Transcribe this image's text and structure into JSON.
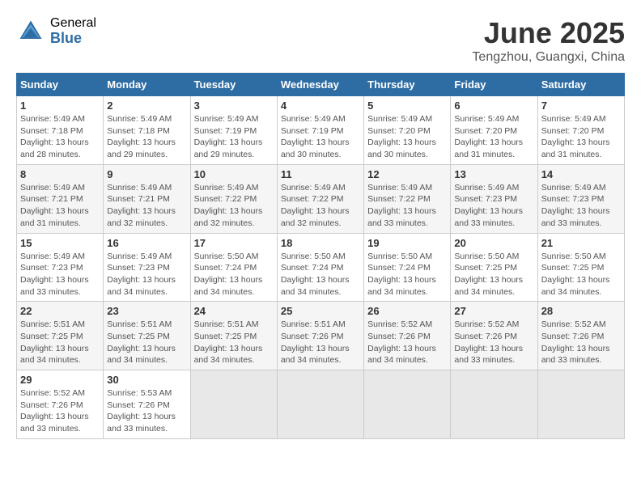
{
  "logo": {
    "general": "General",
    "blue": "Blue"
  },
  "title": "June 2025",
  "location": "Tengzhou, Guangxi, China",
  "weekdays": [
    "Sunday",
    "Monday",
    "Tuesday",
    "Wednesday",
    "Thursday",
    "Friday",
    "Saturday"
  ],
  "weeks": [
    [
      {
        "day": "1",
        "info": "Sunrise: 5:49 AM\nSunset: 7:18 PM\nDaylight: 13 hours\nand 28 minutes."
      },
      {
        "day": "2",
        "info": "Sunrise: 5:49 AM\nSunset: 7:18 PM\nDaylight: 13 hours\nand 29 minutes."
      },
      {
        "day": "3",
        "info": "Sunrise: 5:49 AM\nSunset: 7:19 PM\nDaylight: 13 hours\nand 29 minutes."
      },
      {
        "day": "4",
        "info": "Sunrise: 5:49 AM\nSunset: 7:19 PM\nDaylight: 13 hours\nand 30 minutes."
      },
      {
        "day": "5",
        "info": "Sunrise: 5:49 AM\nSunset: 7:20 PM\nDaylight: 13 hours\nand 30 minutes."
      },
      {
        "day": "6",
        "info": "Sunrise: 5:49 AM\nSunset: 7:20 PM\nDaylight: 13 hours\nand 31 minutes."
      },
      {
        "day": "7",
        "info": "Sunrise: 5:49 AM\nSunset: 7:20 PM\nDaylight: 13 hours\nand 31 minutes."
      }
    ],
    [
      {
        "day": "8",
        "info": "Sunrise: 5:49 AM\nSunset: 7:21 PM\nDaylight: 13 hours\nand 31 minutes."
      },
      {
        "day": "9",
        "info": "Sunrise: 5:49 AM\nSunset: 7:21 PM\nDaylight: 13 hours\nand 32 minutes."
      },
      {
        "day": "10",
        "info": "Sunrise: 5:49 AM\nSunset: 7:22 PM\nDaylight: 13 hours\nand 32 minutes."
      },
      {
        "day": "11",
        "info": "Sunrise: 5:49 AM\nSunset: 7:22 PM\nDaylight: 13 hours\nand 32 minutes."
      },
      {
        "day": "12",
        "info": "Sunrise: 5:49 AM\nSunset: 7:22 PM\nDaylight: 13 hours\nand 33 minutes."
      },
      {
        "day": "13",
        "info": "Sunrise: 5:49 AM\nSunset: 7:23 PM\nDaylight: 13 hours\nand 33 minutes."
      },
      {
        "day": "14",
        "info": "Sunrise: 5:49 AM\nSunset: 7:23 PM\nDaylight: 13 hours\nand 33 minutes."
      }
    ],
    [
      {
        "day": "15",
        "info": "Sunrise: 5:49 AM\nSunset: 7:23 PM\nDaylight: 13 hours\nand 33 minutes."
      },
      {
        "day": "16",
        "info": "Sunrise: 5:49 AM\nSunset: 7:23 PM\nDaylight: 13 hours\nand 34 minutes."
      },
      {
        "day": "17",
        "info": "Sunrise: 5:50 AM\nSunset: 7:24 PM\nDaylight: 13 hours\nand 34 minutes."
      },
      {
        "day": "18",
        "info": "Sunrise: 5:50 AM\nSunset: 7:24 PM\nDaylight: 13 hours\nand 34 minutes."
      },
      {
        "day": "19",
        "info": "Sunrise: 5:50 AM\nSunset: 7:24 PM\nDaylight: 13 hours\nand 34 minutes."
      },
      {
        "day": "20",
        "info": "Sunrise: 5:50 AM\nSunset: 7:25 PM\nDaylight: 13 hours\nand 34 minutes."
      },
      {
        "day": "21",
        "info": "Sunrise: 5:50 AM\nSunset: 7:25 PM\nDaylight: 13 hours\nand 34 minutes."
      }
    ],
    [
      {
        "day": "22",
        "info": "Sunrise: 5:51 AM\nSunset: 7:25 PM\nDaylight: 13 hours\nand 34 minutes."
      },
      {
        "day": "23",
        "info": "Sunrise: 5:51 AM\nSunset: 7:25 PM\nDaylight: 13 hours\nand 34 minutes."
      },
      {
        "day": "24",
        "info": "Sunrise: 5:51 AM\nSunset: 7:25 PM\nDaylight: 13 hours\nand 34 minutes."
      },
      {
        "day": "25",
        "info": "Sunrise: 5:51 AM\nSunset: 7:26 PM\nDaylight: 13 hours\nand 34 minutes."
      },
      {
        "day": "26",
        "info": "Sunrise: 5:52 AM\nSunset: 7:26 PM\nDaylight: 13 hours\nand 34 minutes."
      },
      {
        "day": "27",
        "info": "Sunrise: 5:52 AM\nSunset: 7:26 PM\nDaylight: 13 hours\nand 33 minutes."
      },
      {
        "day": "28",
        "info": "Sunrise: 5:52 AM\nSunset: 7:26 PM\nDaylight: 13 hours\nand 33 minutes."
      }
    ],
    [
      {
        "day": "29",
        "info": "Sunrise: 5:52 AM\nSunset: 7:26 PM\nDaylight: 13 hours\nand 33 minutes."
      },
      {
        "day": "30",
        "info": "Sunrise: 5:53 AM\nSunset: 7:26 PM\nDaylight: 13 hours\nand 33 minutes."
      },
      null,
      null,
      null,
      null,
      null
    ]
  ]
}
